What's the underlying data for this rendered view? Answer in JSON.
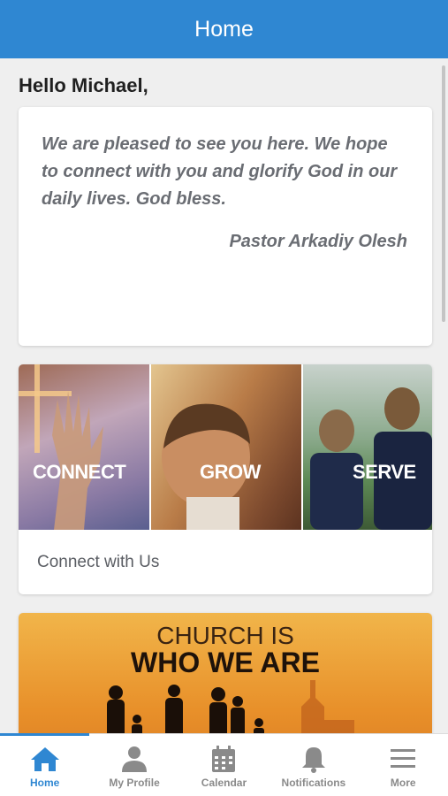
{
  "app_bar": {
    "title": "Home"
  },
  "greeting": "Hello Michael,",
  "welcome_card": {
    "message": "We are pleased to see you here. We hope to connect with you and glorify God in our daily lives. God bless.",
    "signature": "Pastor Arkadiy Olesh"
  },
  "connect_card": {
    "panels": [
      {
        "label": "CONNECT"
      },
      {
        "label": "GROW"
      },
      {
        "label": "SERVE"
      }
    ],
    "caption": "Connect with Us"
  },
  "church_card": {
    "line1": "CHURCH IS",
    "line2": "WHO WE ARE"
  },
  "tabs": [
    {
      "label": "Home",
      "icon": "home-icon",
      "active": true
    },
    {
      "label": "My Profile",
      "icon": "person-icon",
      "active": false
    },
    {
      "label": "Calendar",
      "icon": "calendar-icon",
      "active": false
    },
    {
      "label": "Notifications",
      "icon": "bell-icon",
      "active": false
    },
    {
      "label": "More",
      "icon": "menu-icon",
      "active": false
    }
  ],
  "colors": {
    "primary": "#2f87d2",
    "inactive": "#8a8a8a"
  }
}
